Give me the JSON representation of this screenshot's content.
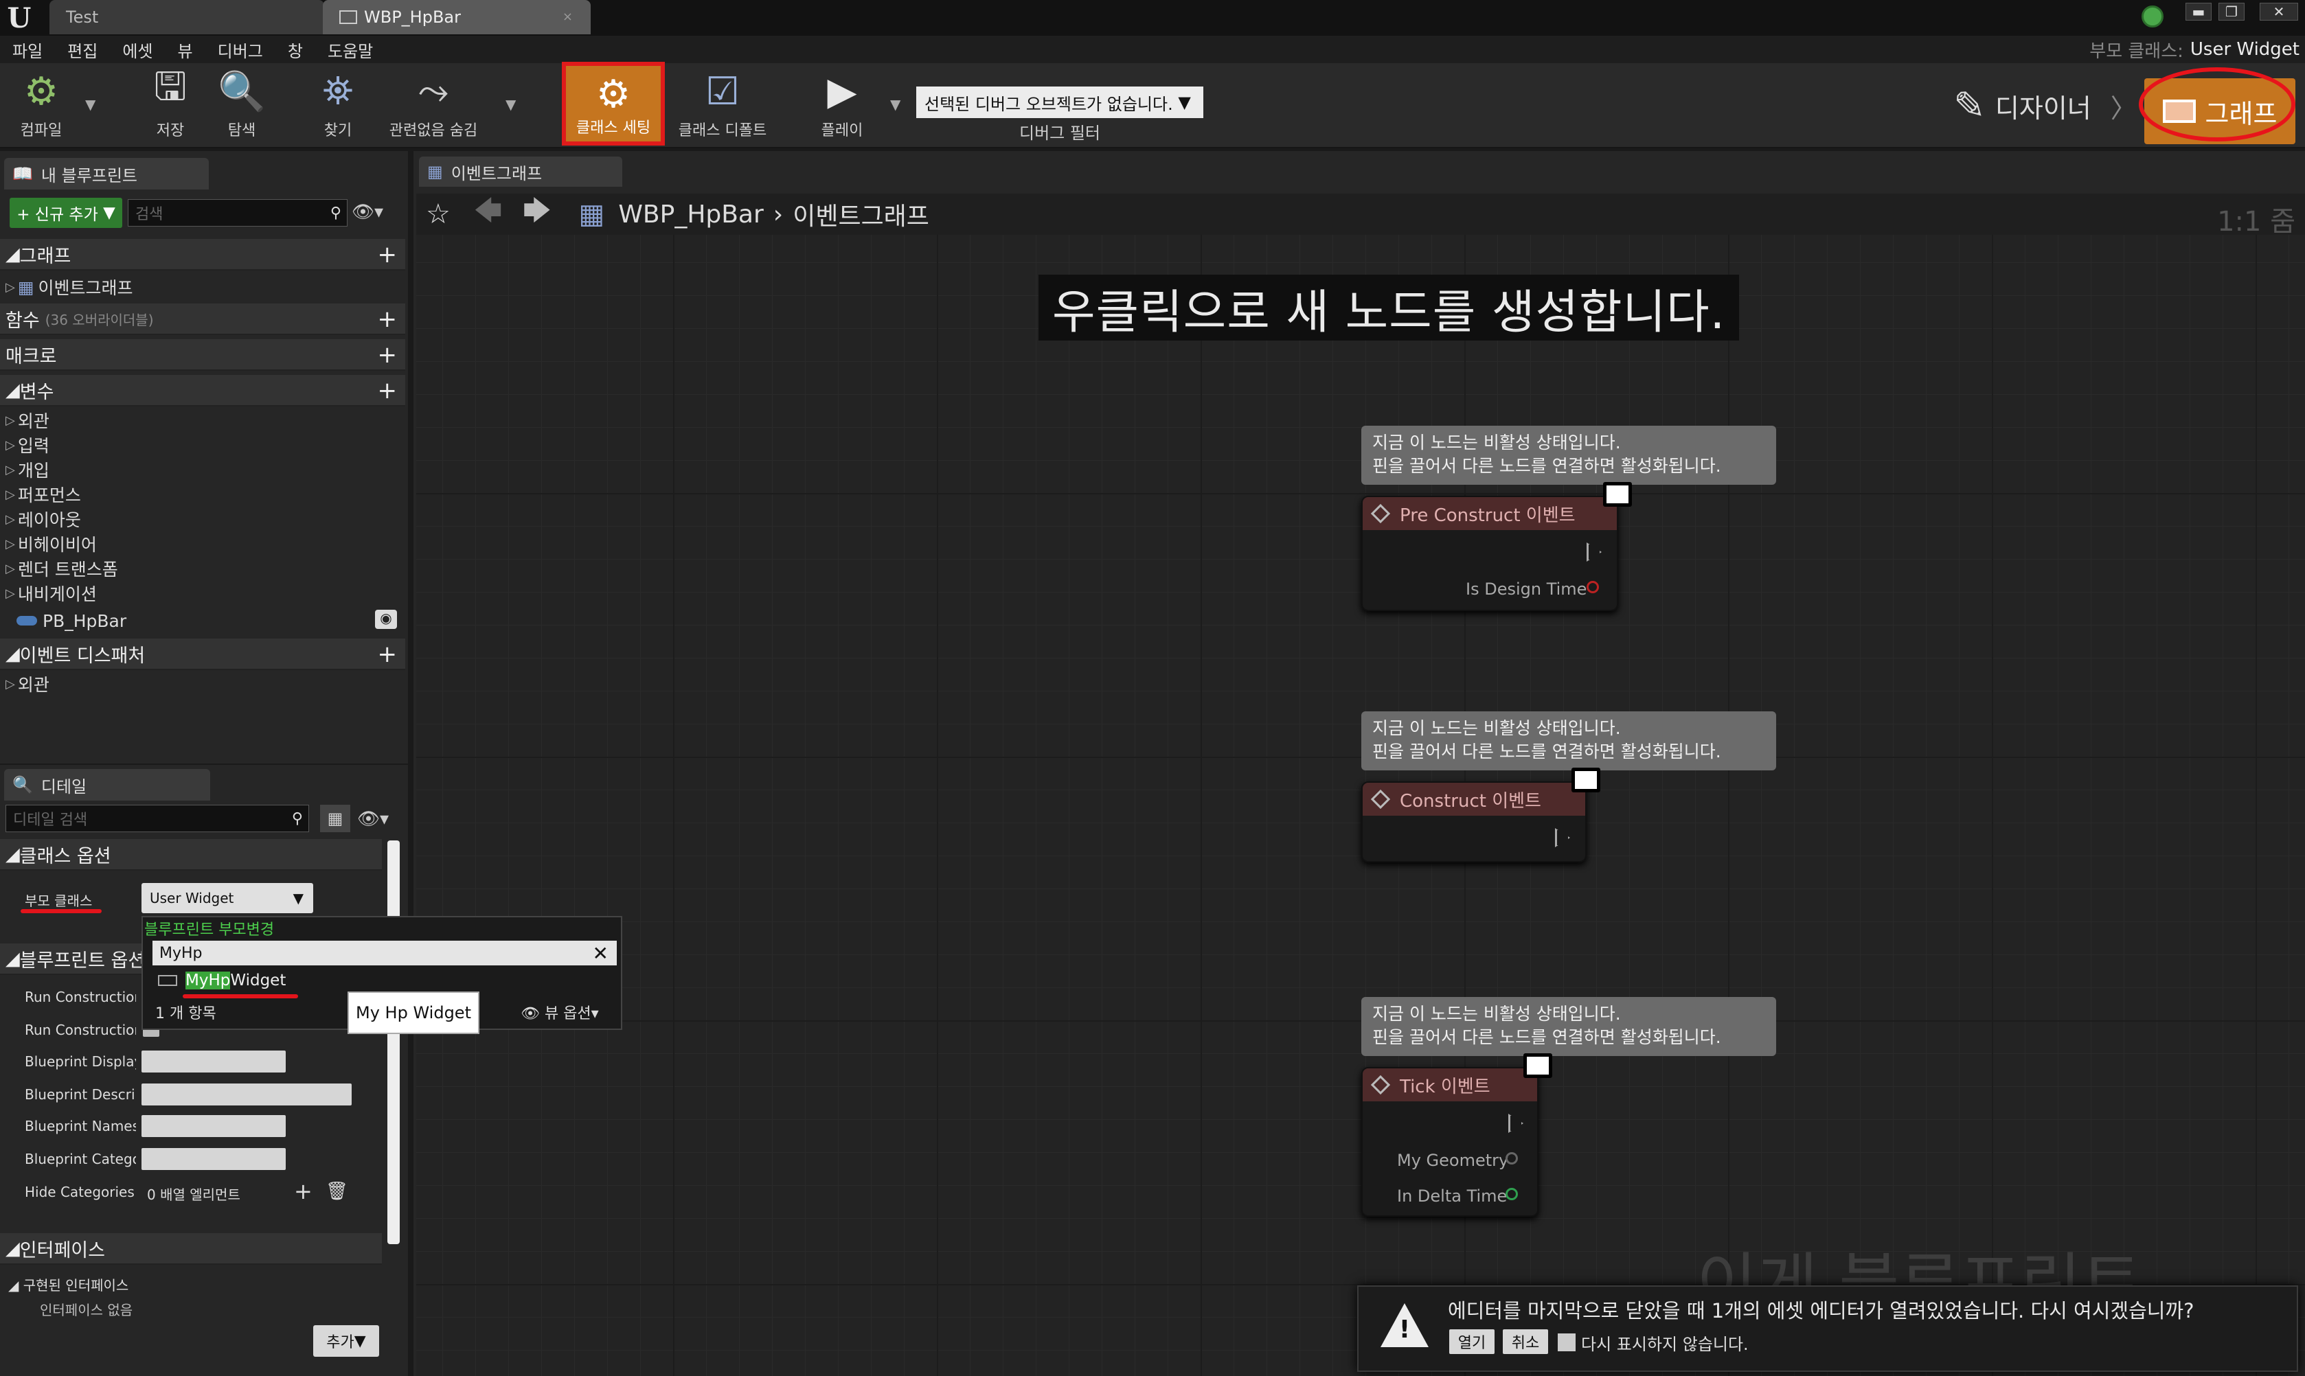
{
  "window": {
    "tabs": [
      {
        "label": "Test"
      },
      {
        "label": "WBP_HpBar",
        "close": "×"
      }
    ],
    "controls": {
      "minimize": "▬",
      "restore": "❐",
      "close": "✕"
    }
  },
  "menu": {
    "items": [
      "파일",
      "편집",
      "에셋",
      "뷰",
      "디버그",
      "창",
      "도움말"
    ],
    "parent_class_label": "부모 클래스:",
    "parent_class_value": "User Widget"
  },
  "toolbar": {
    "compile": "컴파일",
    "save": "저장",
    "browse": "탐색",
    "find": "찾기",
    "hide_unrelated": "관련없음 숨김",
    "class_settings": "클래스 세팅",
    "class_defaults": "클래스 디폴트",
    "play": "플레이",
    "debug_select": "선택된 디버그 오브젝트가 없습니다.",
    "debug_filter": "디버그 필터",
    "designer": "디자이너",
    "graph": "그래프"
  },
  "my_blueprint": {
    "tab": "내 블루프린트",
    "new_button": "+ 신규 추가",
    "search_placeholder": "검색",
    "sections": {
      "graphs": "그래프",
      "event_graph": "이벤트그래프",
      "functions": "함수",
      "functions_note": "(36 오버라이더블)",
      "macros": "매크로",
      "variables": "변수",
      "dispatchers": "이벤트 디스패처"
    },
    "variable_categories": [
      "외관",
      "입력",
      "개입",
      "퍼포먼스",
      "레이아웃",
      "비헤이비어",
      "렌더 트랜스폼",
      "내비게이션"
    ],
    "variable_item": "PB_HpBar",
    "dispatcher_items": [
      "외관"
    ]
  },
  "details": {
    "tab": "디테일",
    "search_placeholder": "디테일 검색",
    "class_options": "클래스 옵션",
    "parent_class_label": "부모 클래스",
    "parent_class_value": "User Widget",
    "blueprint_options": "블루프린트 옵션",
    "rows": [
      "Run Construction",
      "Run Construction",
      "Blueprint Display",
      "Blueprint Descrip",
      "Blueprint Names",
      "Blueprint Categor",
      "Hide Categories"
    ],
    "hide_categories_value": "0 배열 엘리먼트",
    "interfaces": "인터페이스",
    "implemented": "구현된 인터페이스",
    "no_interfaces": "인터페이스 없음",
    "add_button": "추가"
  },
  "reparent_popup": {
    "title": "블루프린트 부모변경",
    "search_value": "MyHp",
    "result_match": "MyHp",
    "result_rest": "Widget",
    "count": "1 개 항목",
    "view_options": "뷰 옵션",
    "tooltip": "My Hp Widget"
  },
  "graph": {
    "tab": "이벤트그래프",
    "breadcrumb_root": "WBP_HpBar",
    "breadcrumb_current": "이벤트그래프",
    "zoom": "1:1 줌",
    "hint": "우클릭으로 새 노드를 생성합니다.",
    "comment_line1": "지금 이 노드는 비활성 상태입니다.",
    "comment_line2": "핀을 끌어서 다른 노드를 연결하면 활성화됩니다.",
    "nodes": [
      {
        "title": "Pre Construct 이벤트",
        "pins": [
          "Is Design Time"
        ]
      },
      {
        "title": "Construct 이벤트",
        "pins": []
      },
      {
        "title": "Tick 이벤트",
        "pins": [
          "My Geometry",
          "In Delta Time"
        ]
      }
    ],
    "watermark": "이게 블루프린트"
  },
  "notification": {
    "message": "에디터를 마지막으로 닫았을 때 1개의 에셋 에디터가 열려있었습니다. 다시 여시겠습니까?",
    "open": "열기",
    "cancel": "취소",
    "dont_show": "다시 표시하지 않습니다."
  },
  "colors": {
    "accent": "#c5751f",
    "highlight": "#e01b1b",
    "node_header": "#4e2a2a"
  }
}
